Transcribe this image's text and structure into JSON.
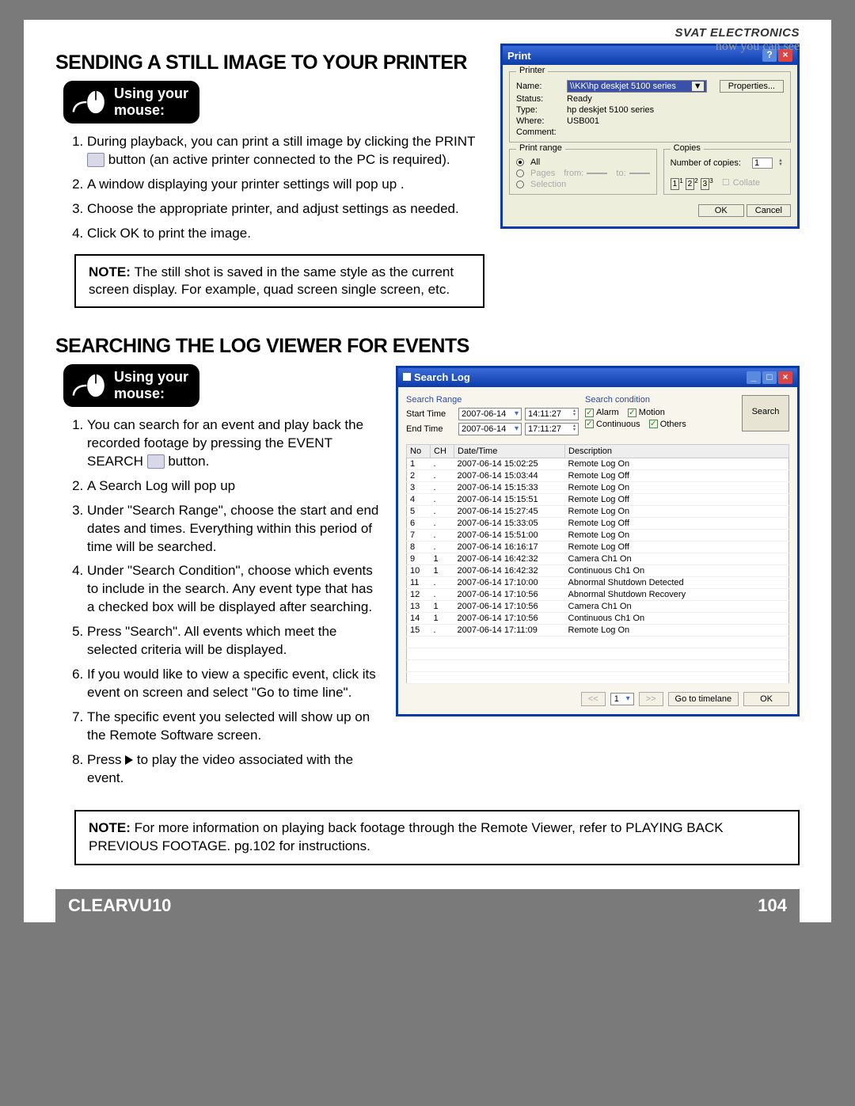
{
  "brand": {
    "company": "SVAT ELECTRONICS",
    "tagline": "now you can see"
  },
  "section1": {
    "heading": "SENDING A STILL IMAGE TO YOUR PRINTER",
    "mouse_badge": "Using your\nmouse:",
    "steps": [
      "During playback, you can print a still image by clicking the PRINT",
      "button (an active printer connected to the PC is required).",
      "A window displaying your printer settings will pop up .",
      "Choose the appropriate printer, and adjust settings as needed.",
      "Click OK to print the image."
    ],
    "note_label": "NOTE:",
    "note_text": "The still shot is saved in the same style as the current screen display.  For example, quad screen single screen, etc."
  },
  "print_dialog": {
    "title": "Print",
    "groups": {
      "printer": "Printer",
      "range": "Print range",
      "copies": "Copies"
    },
    "labels": {
      "name": "Name:",
      "status": "Status:",
      "type": "Type:",
      "where": "Where:",
      "comment": "Comment:",
      "numcopies": "Number of copies:",
      "all": "All",
      "pages": "Pages",
      "from": "from:",
      "to": "to:",
      "selection": "Selection",
      "collate": "Collate"
    },
    "values": {
      "name": "\\\\KK\\hp deskjet 5100 series",
      "status": "Ready",
      "type": "hp deskjet 5100 series",
      "where": "USB001",
      "comment": "",
      "numcopies": "1"
    },
    "buttons": {
      "properties": "Properties...",
      "ok": "OK",
      "cancel": "Cancel"
    }
  },
  "section2": {
    "heading": "SEARCHING THE LOG VIEWER FOR EVENTS",
    "mouse_badge": "Using your\nmouse:",
    "steps": [
      "You can search for an event and play back the recorded footage by pressing the EVENT SEARCH",
      "button.",
      "A Search Log will pop up",
      "Under \"Search Range\", choose the start and end dates and times.  Everything within this period of time will be searched.",
      "Under \"Search Condition\", choose which events to include in the search.  Any event type that has a checked box will be displayed after searching.",
      "Press \"Search\".  All events which meet the selected criteria will be displayed.",
      "If you would like to view a specific event, click its event on screen and select \"Go to time line\".",
      "The specific event you selected will show up on the Remote Software screen.",
      "Press ▶ to play the video associated with the event."
    ],
    "note_label": "NOTE:",
    "note_text": "For more information on playing back footage through the Remote Viewer, refer to PLAYING BACK PREVIOUS FOOTAGE. pg.102 for instructions."
  },
  "search_dialog": {
    "title": "Search Log",
    "range_title": "Search Range",
    "cond_title": "Search condition",
    "labels": {
      "start": "Start Time",
      "end": "End Time",
      "search_btn": "Search"
    },
    "dates": {
      "start_date": "2007-06-14",
      "start_time": "14:11:27",
      "end_date": "2007-06-14",
      "end_time": "17:11:27"
    },
    "conditions": {
      "alarm": "Alarm",
      "motion": "Motion",
      "continuous": "Continuous",
      "others": "Others"
    },
    "columns": {
      "no": "No",
      "ch": "CH",
      "dt": "Date/Time",
      "desc": "Description"
    },
    "rows": [
      {
        "no": "1",
        "ch": ".",
        "dt": "2007-06-14 15:02:25",
        "desc": "Remote Log On"
      },
      {
        "no": "2",
        "ch": ".",
        "dt": "2007-06-14 15:03:44",
        "desc": "Remote Log Off"
      },
      {
        "no": "3",
        "ch": ".",
        "dt": "2007-06-14 15:15:33",
        "desc": "Remote Log On"
      },
      {
        "no": "4",
        "ch": ".",
        "dt": "2007-06-14 15:15:51",
        "desc": "Remote Log Off"
      },
      {
        "no": "5",
        "ch": ".",
        "dt": "2007-06-14 15:27:45",
        "desc": "Remote Log On"
      },
      {
        "no": "6",
        "ch": ".",
        "dt": "2007-06-14 15:33:05",
        "desc": "Remote Log Off"
      },
      {
        "no": "7",
        "ch": ".",
        "dt": "2007-06-14 15:51:00",
        "desc": "Remote Log On"
      },
      {
        "no": "8",
        "ch": ".",
        "dt": "2007-06-14 16:16:17",
        "desc": "Remote Log Off"
      },
      {
        "no": "9",
        "ch": "1",
        "dt": "2007-06-14 16:42:32",
        "desc": "Camera Ch1 On"
      },
      {
        "no": "10",
        "ch": "1",
        "dt": "2007-06-14 16:42:32",
        "desc": "Continuous Ch1 On"
      },
      {
        "no": "11",
        "ch": ".",
        "dt": "2007-06-14 17:10:00",
        "desc": "Abnormal Shutdown Detected"
      },
      {
        "no": "12",
        "ch": ".",
        "dt": "2007-06-14 17:10:56",
        "desc": "Abnormal Shutdown Recovery"
      },
      {
        "no": "13",
        "ch": "1",
        "dt": "2007-06-14 17:10:56",
        "desc": "Camera Ch1 On"
      },
      {
        "no": "14",
        "ch": "1",
        "dt": "2007-06-14 17:10:56",
        "desc": "Continuous Ch1 On"
      },
      {
        "no": "15",
        "ch": ".",
        "dt": "2007-06-14 17:11:09",
        "desc": "Remote Log On"
      }
    ],
    "foot": {
      "prev": "<<",
      "page": "1",
      "next": ">>",
      "goto": "Go to timelane",
      "ok": "OK"
    }
  },
  "footer": {
    "model": "CLEARVU10",
    "page": "104"
  }
}
